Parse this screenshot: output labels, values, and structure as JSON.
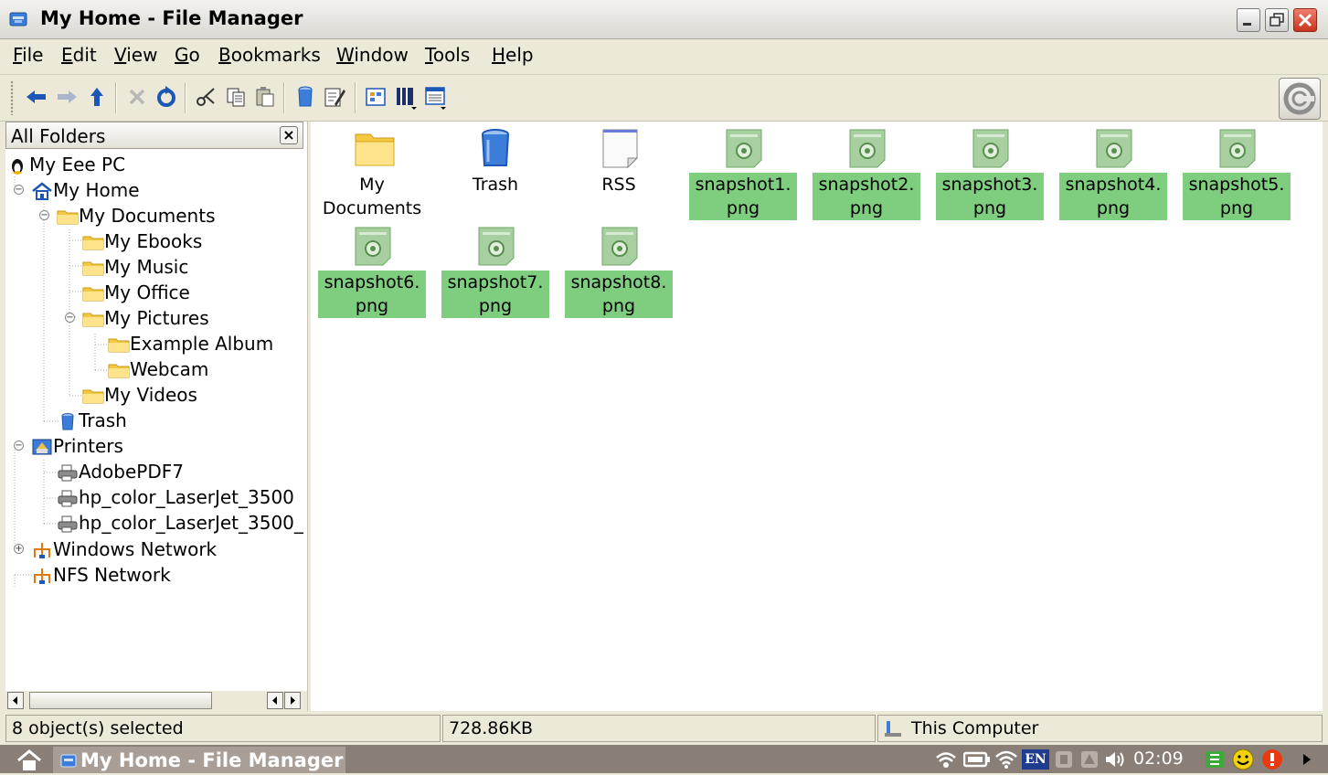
{
  "window": {
    "title": "My Home - File Manager",
    "controls": [
      "minimize",
      "restore",
      "close"
    ]
  },
  "menu": [
    {
      "label": "File",
      "mnemonic": "F",
      "rest": "ile"
    },
    {
      "label": "Edit",
      "mnemonic": "E",
      "rest": "dit"
    },
    {
      "label": "View",
      "mnemonic": "V",
      "rest": "iew"
    },
    {
      "label": "Go",
      "mnemonic": "G",
      "rest": "o"
    },
    {
      "label": "Bookmarks",
      "mnemonic": "B",
      "rest": "ookmarks"
    },
    {
      "label": "Window",
      "mnemonic": "W",
      "rest": "indow"
    },
    {
      "label": "Tools",
      "mnemonic": "T",
      "rest": "ools"
    },
    {
      "label": "Help",
      "mnemonic": "H",
      "rest": "elp"
    }
  ],
  "toolbar": {
    "buttons": [
      "back-icon",
      "forward-icon",
      "up-icon",
      "stop-icon",
      "reload-icon",
      "cut-icon",
      "copy-icon",
      "paste-icon",
      "trash-icon",
      "properties-icon",
      "icon-view-icon",
      "detail-view-icon",
      "list-view-icon"
    ]
  },
  "sidebar": {
    "header": "All Folders",
    "tree": [
      {
        "label": "My Eee PC",
        "icon": "tux-icon"
      },
      {
        "label": "My Home",
        "icon": "home-icon"
      },
      {
        "label": "My Documents",
        "icon": "folder-icon"
      },
      {
        "label": "My Ebooks",
        "icon": "folder-icon"
      },
      {
        "label": "My Music",
        "icon": "folder-icon"
      },
      {
        "label": "My Office",
        "icon": "folder-icon"
      },
      {
        "label": "My Pictures",
        "icon": "folder-icon"
      },
      {
        "label": "Example Album",
        "icon": "folder-icon"
      },
      {
        "label": "Webcam",
        "icon": "folder-icon"
      },
      {
        "label": "My Videos",
        "icon": "folder-icon"
      },
      {
        "label": "Trash",
        "icon": "trash-icon"
      },
      {
        "label": "Printers",
        "icon": "printers-icon"
      },
      {
        "label": "AdobePDF7",
        "icon": "printer-icon"
      },
      {
        "label": "hp_color_LaserJet_3500",
        "icon": "printer-icon"
      },
      {
        "label": "hp_color_LaserJet_3500_",
        "icon": "printer-icon"
      },
      {
        "label": "Windows Network",
        "icon": "network-icon"
      },
      {
        "label": "NFS Network",
        "icon": "network-icon"
      }
    ]
  },
  "files": [
    {
      "line1": "My",
      "line2": "Documents",
      "icon": "folder-icon",
      "selected": false
    },
    {
      "line1": "Trash",
      "line2": "",
      "icon": "trash-icon",
      "selected": false
    },
    {
      "line1": "RSS",
      "line2": "",
      "icon": "file-icon",
      "selected": false
    },
    {
      "line1": "snapshot1.",
      "line2": "png",
      "icon": "image-file-icon",
      "selected": true
    },
    {
      "line1": "snapshot2.",
      "line2": "png",
      "icon": "image-file-icon",
      "selected": true
    },
    {
      "line1": "snapshot3.",
      "line2": "png",
      "icon": "image-file-icon",
      "selected": true
    },
    {
      "line1": "snapshot4.",
      "line2": "png",
      "icon": "image-file-icon",
      "selected": true
    },
    {
      "line1": "snapshot5.",
      "line2": "png",
      "icon": "image-file-icon",
      "selected": true
    },
    {
      "line1": "snapshot6.",
      "line2": "png",
      "icon": "image-file-icon",
      "selected": true
    },
    {
      "line1": "snapshot7.",
      "line2": "png",
      "icon": "image-file-icon",
      "selected": true
    },
    {
      "line1": "snapshot8.",
      "line2": "png",
      "icon": "image-file-icon",
      "selected": true
    }
  ],
  "status": {
    "selection": "8 object(s) selected",
    "size": "728.86KB",
    "zone": "This Computer"
  },
  "taskbar": {
    "task_label": "My Home - File Manager",
    "clock": "02:09",
    "tray_icons": [
      "wireless-icon",
      "battery-icon",
      "wifi-icon",
      "keyboard-layout-icon",
      "tray-app-icon",
      "tray-app-icon",
      "volume-icon",
      "clock",
      "apps-icon",
      "smiley-icon",
      "power-icon",
      "arrow-icon"
    ],
    "keyboard_layout": "EN"
  },
  "colors": {
    "selection": "#7fcd7f",
    "window_bg": "#ece9d8",
    "taskbar": "#8a7f77"
  }
}
